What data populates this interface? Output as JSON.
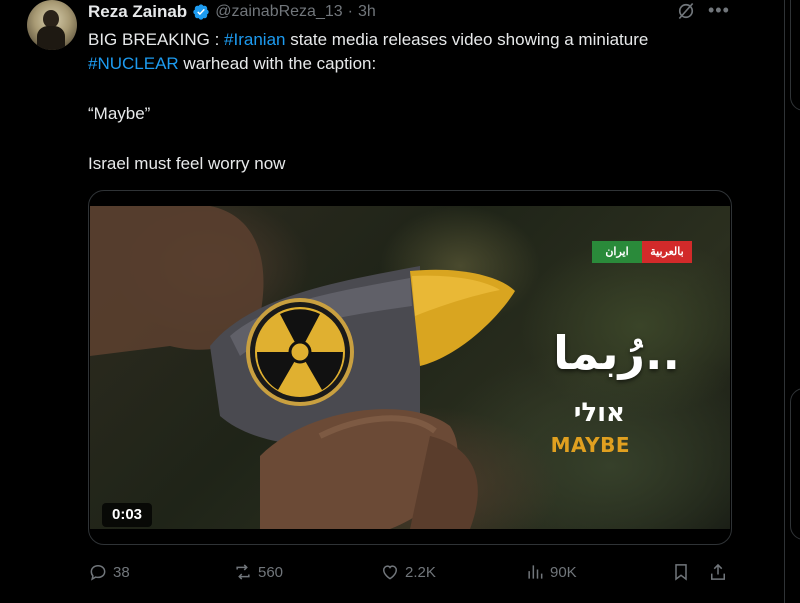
{
  "author": {
    "name": "Reza Zainab",
    "handle": "@zainabReza_13",
    "separator": "·",
    "time": "3h"
  },
  "tweet": {
    "line1_prefix": "BIG BREAKING : ",
    "line1_tag": "#Iranian",
    "line1_suffix": " state media releases video showing a miniature",
    "line2_tag": "#NUCLEAR",
    "line2_suffix": " warhead with the caption:",
    "quote": "“Maybe”",
    "closing": "Israel must feel worry now"
  },
  "video": {
    "channel_badge_left": "ايران",
    "channel_badge_right": "بالعربية",
    "caption_arabic": "رُبما..",
    "caption_hebrew": "אולי",
    "caption_english": "MAYBE",
    "duration": "0:03"
  },
  "actions": {
    "replies": "38",
    "reposts": "560",
    "likes": "2.2K",
    "views": "90K"
  },
  "icons": [
    "verified-icon",
    "grok-icon",
    "more-icon",
    "reply-icon",
    "repost-icon",
    "like-icon",
    "views-icon",
    "bookmark-icon",
    "share-icon"
  ],
  "colors": {
    "background": "#000000",
    "text": "#e7e9ea",
    "muted": "#71767b",
    "link": "#1d9bf0",
    "verified": "#1d9bf0"
  }
}
